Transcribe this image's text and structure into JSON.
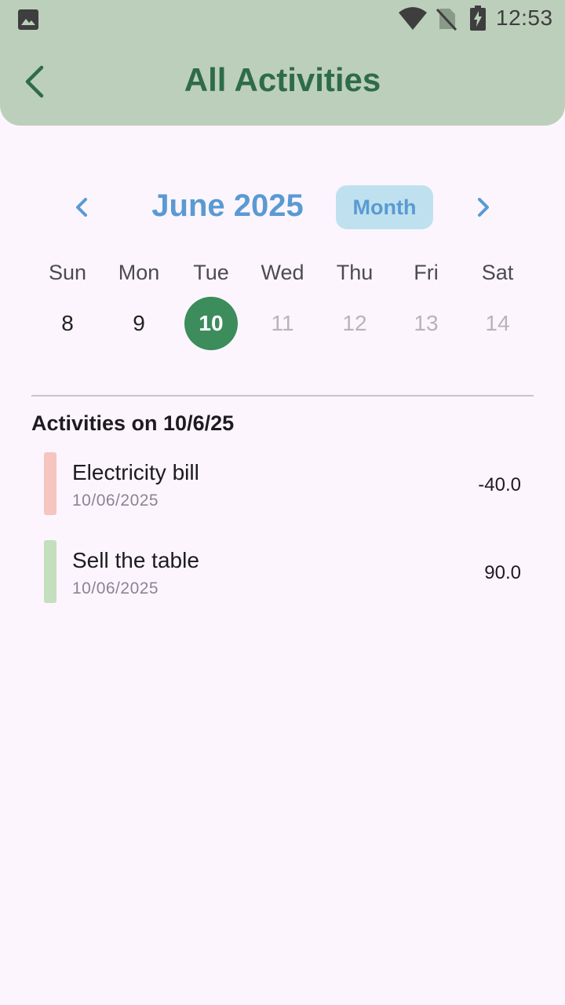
{
  "status_bar": {
    "time": "12:53",
    "icons": [
      "photo-icon",
      "wifi-icon",
      "no-sim-icon",
      "battery-charging-icon"
    ]
  },
  "app_bar": {
    "title": "All Activities",
    "back_icon": "chevron-left-icon"
  },
  "calendar": {
    "month_label": "June 2025",
    "mode_button": "Month",
    "weekdays": [
      "Sun",
      "Mon",
      "Tue",
      "Wed",
      "Thu",
      "Fri",
      "Sat"
    ],
    "days": [
      "8",
      "9",
      "10",
      "11",
      "12",
      "13",
      "14"
    ],
    "selected_day": "10"
  },
  "activities_section": {
    "title": "Activities on 10/6/25",
    "items": [
      {
        "name": "Electricity bill",
        "date": "10/06/2025",
        "amount": "-40.0",
        "color": "#f7c5c0"
      },
      {
        "name": "Sell the table",
        "date": "10/06/2025",
        "amount": "90.0",
        "color": "#c3dfbe"
      }
    ]
  },
  "colors": {
    "app_bar_bg": "#bccfbb",
    "title_green": "#2e6c47",
    "accent_blue": "#5a9ad2",
    "selected_day_bg": "#3c8c5c",
    "page_bg": "#fcf5fd"
  }
}
